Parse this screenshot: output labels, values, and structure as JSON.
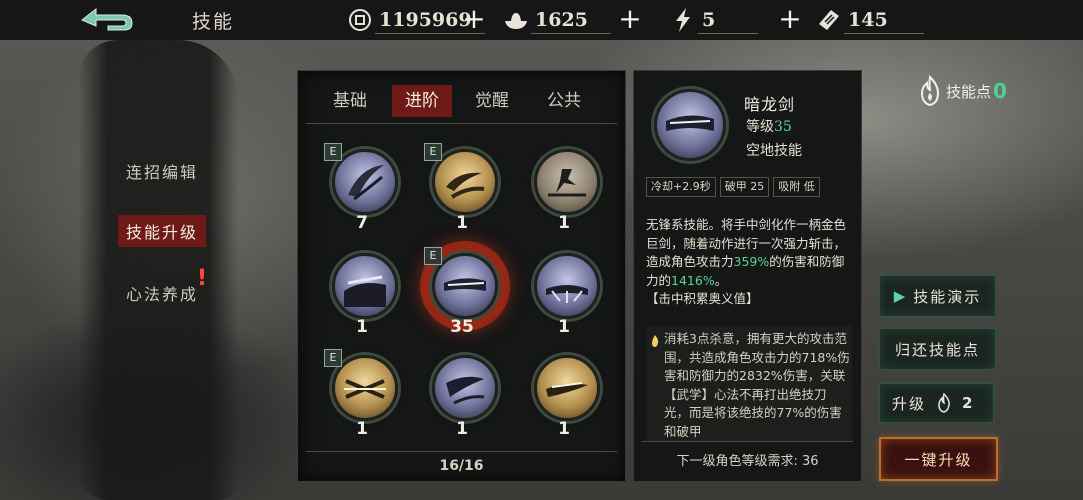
{
  "header": {
    "title": "技能",
    "resources": [
      {
        "icon": "coin-icon",
        "value": "1195969"
      },
      {
        "icon": "silver-ingot-icon",
        "value": "1625"
      },
      {
        "icon": "lightning-icon",
        "value": "5"
      },
      {
        "icon": "ticket-icon",
        "value": "145"
      }
    ]
  },
  "sidebar": {
    "items": [
      {
        "label": "连招编辑"
      },
      {
        "label": "技能升级"
      },
      {
        "label": "心法养成"
      }
    ],
    "alert": "!"
  },
  "tabs": [
    {
      "label": "基础"
    },
    {
      "label": "进阶"
    },
    {
      "label": "觉醒"
    },
    {
      "label": "公共"
    }
  ],
  "active_tab": "进阶",
  "skills": [
    {
      "level": "7",
      "badge": "E"
    },
    {
      "level": "1",
      "badge": "E"
    },
    {
      "level": "1",
      "badge": ""
    },
    {
      "level": "1",
      "badge": ""
    },
    {
      "level": "35",
      "badge": "E"
    },
    {
      "level": "1",
      "badge": ""
    },
    {
      "level": "1",
      "badge": "E"
    },
    {
      "level": "1",
      "badge": ""
    },
    {
      "level": "1",
      "badge": ""
    }
  ],
  "page_count": "16/16",
  "detail": {
    "name": "暗龙剑",
    "level_label": "等级",
    "level_value": "35",
    "type": "空地技能",
    "stats": [
      "冷却+2.9秒",
      "破甲 25",
      "吸附 低"
    ],
    "desc_1": "无锋系技能。将手中剑化作一柄金色巨剑，随着动作进行一次强力斩击，造成角色攻击力",
    "desc_pct_1": "359%",
    "desc_2": "的伤害和防御力的",
    "desc_pct_2": "1416%",
    "desc_3": "。",
    "desc_tag": "【击中积累奥义值】",
    "effect": "消耗3点杀意，拥有更大的攻击范围，共造成角色攻击力的718%伤害和防御力的2832%伤害，关联【武学】心法不再打出绝技刀光，而是将该绝技的77%的伤害和破甲",
    "requirement": "下一级角色等级需求: 36"
  },
  "skill_points": {
    "label": "技能点",
    "value": "0"
  },
  "buttons": {
    "demo": "技能演示",
    "refund": "归还技能点",
    "upgrade": "升级",
    "upgrade_cost": "2",
    "one_click": "一键升级"
  },
  "colors": {
    "accent_green": "#59d49a",
    "active_red": "#6e1b17",
    "one_click_border": "#b8702b"
  }
}
